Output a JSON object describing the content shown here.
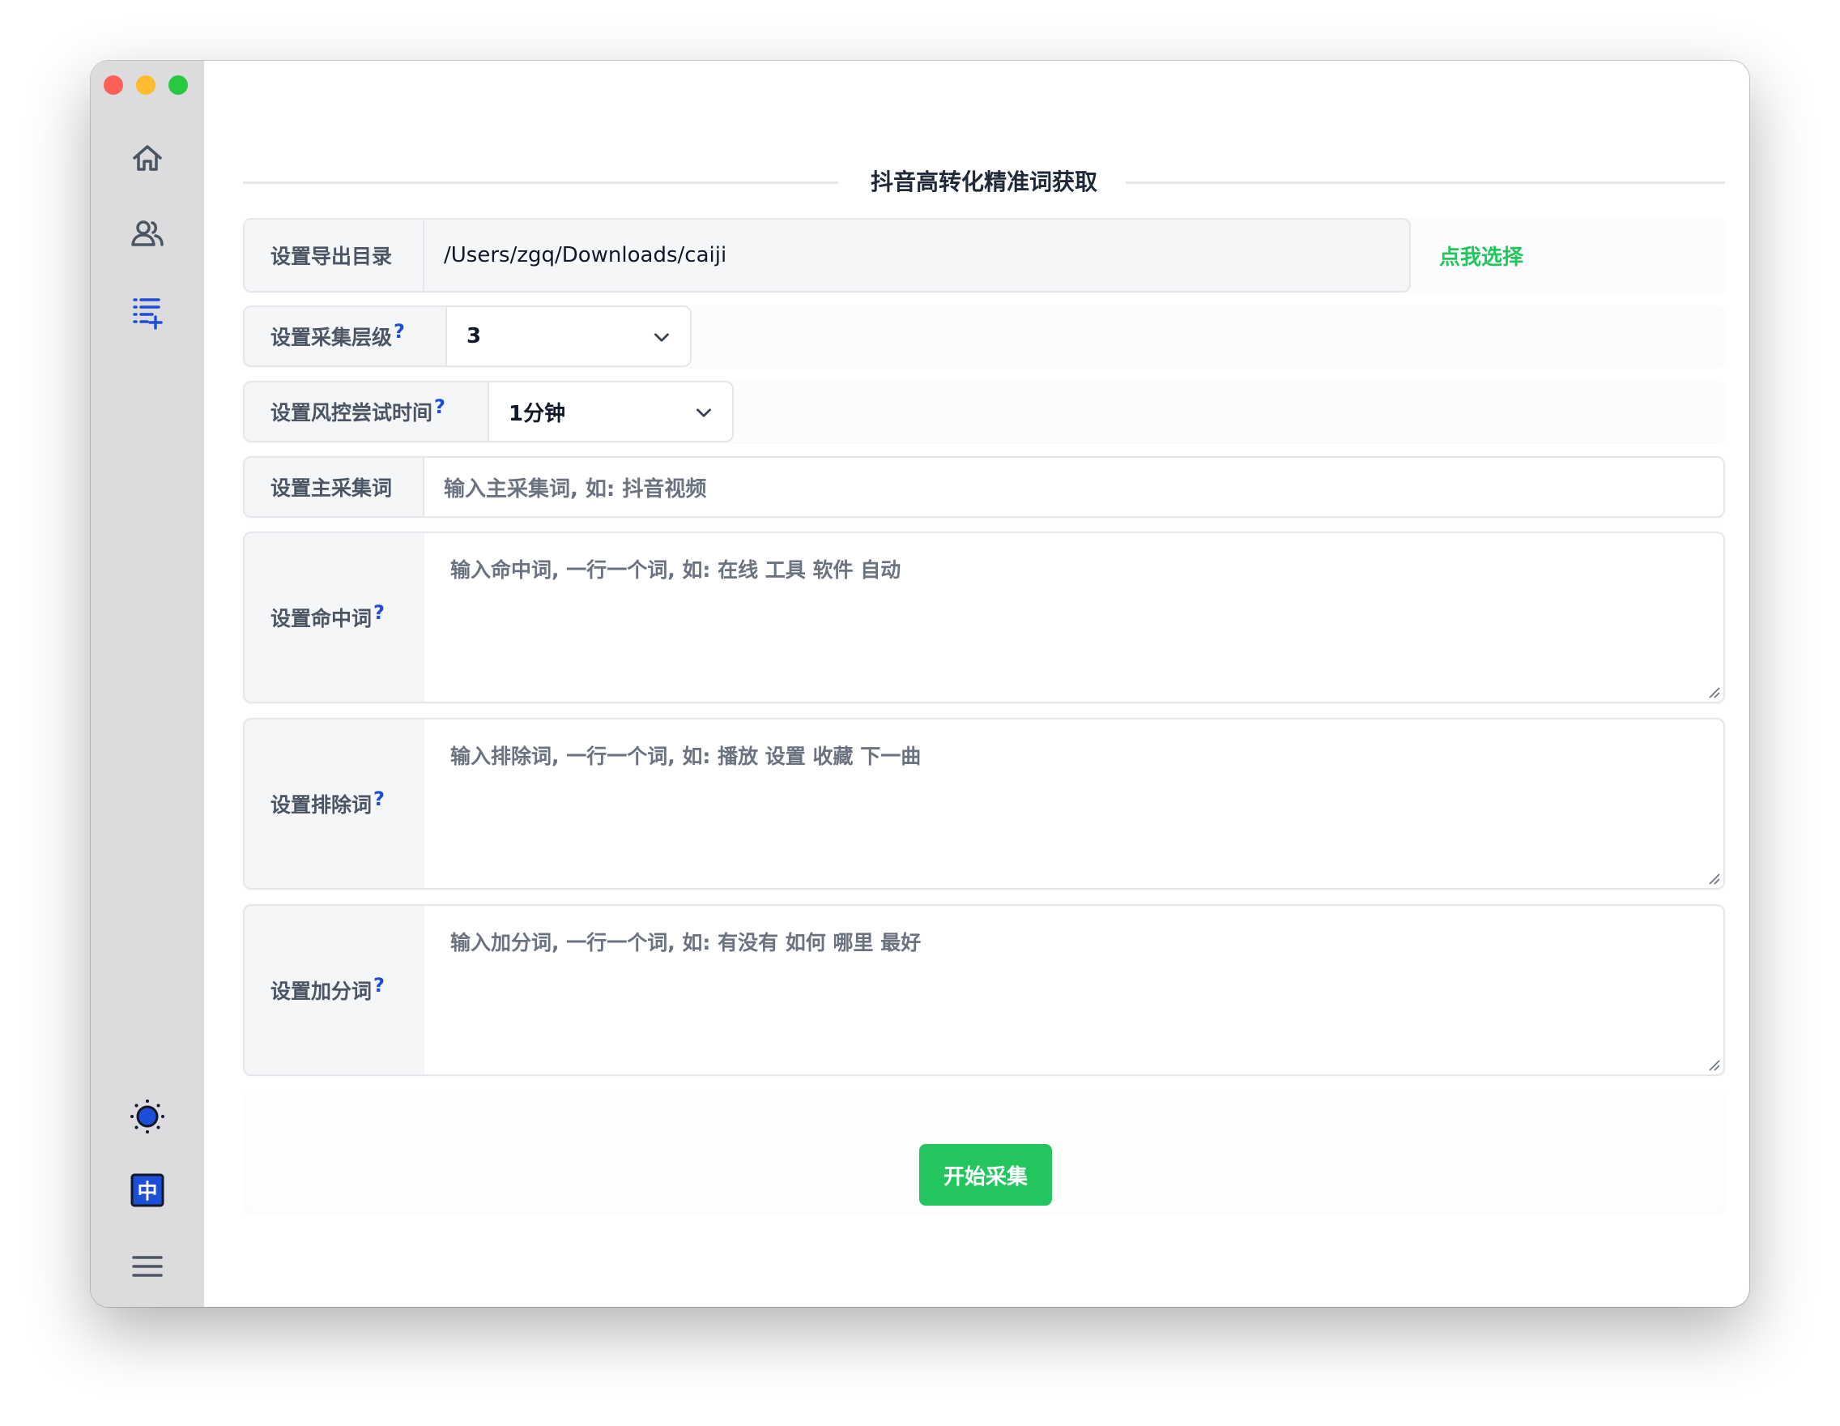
{
  "window": {
    "title": "抖音高转化精准词获取"
  },
  "sidebar": {
    "items": [
      {
        "icon": "home-icon"
      },
      {
        "icon": "users-icon"
      },
      {
        "icon": "list-add-icon"
      }
    ],
    "bottom": [
      {
        "icon": "theme-toggle-icon"
      },
      {
        "icon": "language-icon",
        "label": "中"
      },
      {
        "icon": "menu-icon"
      }
    ],
    "accent_color": "#1d4ed8"
  },
  "form": {
    "export_dir": {
      "label": "设置导出目录",
      "value": "/Users/zgq/Downloads/caiji",
      "choose_label": "点我选择"
    },
    "level": {
      "label": "设置采集层级",
      "help": "?",
      "value": "3"
    },
    "risk_time": {
      "label": "设置风控尝试时间",
      "help": "?",
      "value": "1分钟"
    },
    "main_word": {
      "label": "设置主采集词",
      "placeholder": "输入主采集词, 如: 抖音视频"
    },
    "hit_words": {
      "label": "设置命中词",
      "help": "?",
      "placeholder": "输入命中词, 一行一个词, 如: 在线 工具 软件 自动"
    },
    "exclude_words": {
      "label": "设置排除词",
      "help": "?",
      "placeholder": "输入排除词, 一行一个词, 如: 播放 设置 收藏 下一曲"
    },
    "bonus_words": {
      "label": "设置加分词",
      "help": "?",
      "placeholder": "输入加分词, 一行一个词, 如: 有没有 如何 哪里 最好"
    },
    "submit_label": "开始采集"
  },
  "colors": {
    "primary": "#22c55e",
    "help": "#1d4ed8"
  }
}
